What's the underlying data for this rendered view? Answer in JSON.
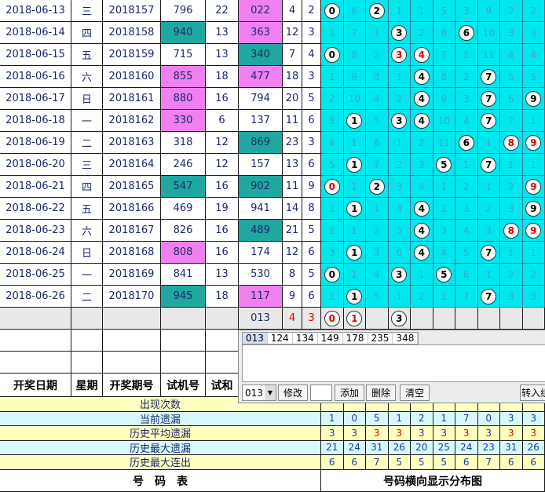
{
  "rows": [
    [
      "2018-06-13",
      "三",
      "2018157",
      "796",
      "22",
      "022",
      "4",
      "2"
    ],
    [
      "2018-06-14",
      "四",
      "2018158",
      "940",
      "13",
      "363",
      "12",
      "3"
    ],
    [
      "2018-06-15",
      "五",
      "2018159",
      "715",
      "13",
      "340",
      "7",
      "4"
    ],
    [
      "2018-06-16",
      "六",
      "2018160",
      "855",
      "18",
      "477",
      "18",
      "3"
    ],
    [
      "2018-06-17",
      "日",
      "2018161",
      "880",
      "16",
      "794",
      "20",
      "5"
    ],
    [
      "2018-06-18",
      "一",
      "2018162",
      "330",
      "6",
      "137",
      "11",
      "6"
    ],
    [
      "2018-06-19",
      "二",
      "2018163",
      "318",
      "12",
      "869",
      "23",
      "3"
    ],
    [
      "2018-06-20",
      "三",
      "2018164",
      "246",
      "12",
      "157",
      "13",
      "6"
    ],
    [
      "2018-06-21",
      "四",
      "2018165",
      "547",
      "16",
      "902",
      "11",
      "9"
    ],
    [
      "2018-06-22",
      "五",
      "2018166",
      "469",
      "19",
      "941",
      "14",
      "8"
    ],
    [
      "2018-06-23",
      "六",
      "2018167",
      "826",
      "16",
      "489",
      "21",
      "5"
    ],
    [
      "2018-06-24",
      "日",
      "2018168",
      "808",
      "16",
      "174",
      "12",
      "6"
    ],
    [
      "2018-06-25",
      "一",
      "2018169",
      "841",
      "13",
      "530",
      "8",
      "5"
    ],
    [
      "2018-06-26",
      "二",
      "2018170",
      "945",
      "18",
      "117",
      "9",
      "6"
    ]
  ],
  "shiji_color": [
    "",
    "teal",
    "",
    "pink",
    "pink",
    "pink",
    "",
    "",
    "teal",
    "",
    "",
    "pink",
    "",
    "teal"
  ],
  "kj_color": [
    "pink",
    "pink",
    "teal",
    "pink",
    "",
    "",
    "teal",
    "",
    "teal",
    "",
    "teal",
    "",
    "",
    "pink"
  ],
  "dist": [
    [
      "0",
      "6",
      "2",
      "1",
      "1",
      "5",
      "3",
      "9",
      "2",
      "2"
    ],
    [
      "1",
      "7",
      "1",
      "3",
      "2",
      "6",
      "6",
      "10",
      "3",
      "3"
    ],
    [
      "0",
      "8",
      "2",
      "3",
      "4",
      "7",
      "1",
      "11",
      "4",
      "4"
    ],
    [
      "1",
      "9",
      "3",
      "1",
      "4",
      "8",
      "2",
      "7",
      "5",
      "5"
    ],
    [
      "2",
      "10",
      "4",
      "2",
      "4",
      "9",
      "3",
      "7",
      "6",
      "9"
    ],
    [
      "3",
      "1",
      "5",
      "3",
      "1",
      "10",
      "4",
      "7",
      "7",
      "1"
    ],
    [
      "4",
      "1",
      "6",
      "1",
      "2",
      "11",
      "6",
      "1",
      "8",
      "9"
    ],
    [
      "5",
      "1",
      "7",
      "2",
      "3",
      "5",
      "1",
      "7",
      "1",
      "1"
    ],
    [
      "0",
      "1",
      "2",
      "3",
      "4",
      "1",
      "2",
      "1",
      "2",
      "9"
    ],
    [
      "1",
      "1",
      "1",
      "4",
      "4",
      "2",
      "3",
      "2",
      "3",
      "9"
    ],
    [
      "2",
      "1",
      "2",
      "5",
      "4",
      "3",
      "4",
      "3",
      "8",
      "9"
    ],
    [
      "3",
      "1",
      "3",
      "6",
      "4",
      "4",
      "5",
      "7",
      "1",
      "1"
    ],
    [
      "0",
      "1",
      "4",
      "3",
      "1",
      "5",
      "6",
      "1",
      "2",
      "2"
    ],
    [
      "1",
      "1",
      "5",
      "1",
      "2",
      "1",
      "7",
      "7",
      "3",
      "3"
    ]
  ],
  "balls": [
    [
      0,
      2
    ],
    [
      3,
      6
    ],
    [
      0,
      3,
      4
    ],
    [
      4,
      7
    ],
    [
      4,
      7,
      9
    ],
    [
      1,
      3,
      4,
      7
    ],
    [
      6,
      8,
      9
    ],
    [
      1,
      5,
      7
    ],
    [
      0,
      2,
      9
    ],
    [
      1,
      4,
      9
    ],
    [
      4,
      8,
      9
    ],
    [
      1,
      4,
      7
    ],
    [
      0,
      3,
      5
    ],
    [
      1,
      7
    ]
  ],
  "red_balls": [
    [],
    [],
    [
      3,
      4
    ],
    [],
    [],
    [],
    [
      8,
      9
    ],
    [],
    [
      0,
      9
    ],
    [],
    [
      8,
      9
    ],
    [],
    [],
    []
  ],
  "pred_row": {
    "kj": "013",
    "a": "4",
    "b": "3",
    "balls": [
      "0",
      "1",
      "",
      "3"
    ]
  },
  "headers": {
    "date": "开奖日期",
    "week": "星期",
    "issue": "开奖期号",
    "sj": "试机号",
    "sh": "试和"
  },
  "panel": {
    "tabs": [
      "013",
      "124",
      "134",
      "149",
      "178",
      "235",
      "348"
    ],
    "select": "013",
    "edit": "修改",
    "add": "添加",
    "del": "删除",
    "clear": "清空",
    "transfer": "转入组"
  },
  "stat_labels": [
    "出现次数",
    "当前遗漏",
    "历史平均遗漏",
    "历史最大遗漏",
    "历史最大连出"
  ],
  "stats": [
    [
      "",
      "",
      "",
      "",
      "",
      "",
      "",
      "",
      "",
      ""
    ],
    [
      "1",
      "0",
      "5",
      "1",
      "2",
      "1",
      "7",
      "0",
      "3",
      "3"
    ],
    [
      "3",
      "3",
      "3",
      "3",
      "3",
      "3",
      "3",
      "3",
      "3",
      "3"
    ],
    [
      "21",
      "24",
      "31",
      "26",
      "20",
      "25",
      "24",
      "23",
      "31",
      "26"
    ],
    [
      "6",
      "6",
      "7",
      "5",
      "5",
      "5",
      "6",
      "7",
      "6",
      "6"
    ]
  ],
  "footer": {
    "left": "号　码　表",
    "right": "号码横向显示分布图"
  }
}
